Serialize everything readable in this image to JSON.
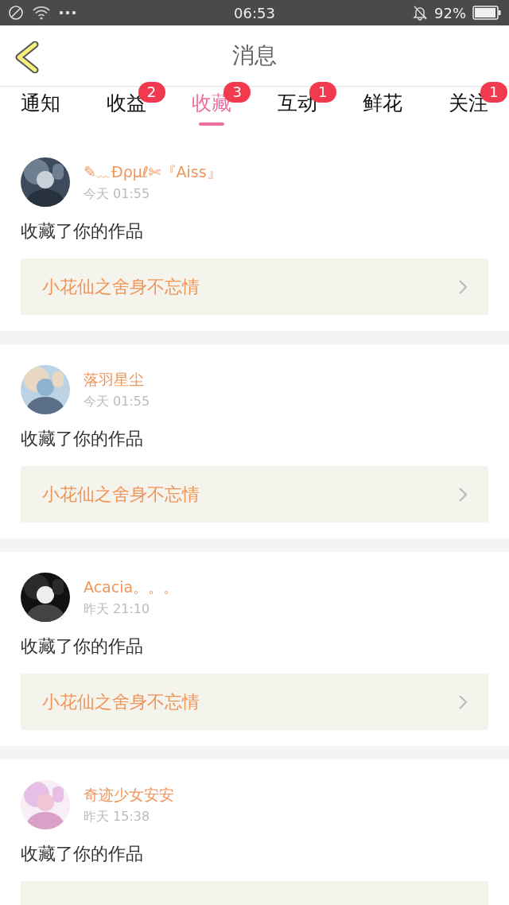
{
  "status_bar": {
    "time": "06:53",
    "battery": "92%"
  },
  "header": {
    "title": "消息"
  },
  "tabs": [
    {
      "label": "通知",
      "selected": false
    },
    {
      "label": "收益",
      "selected": false,
      "badge": "2"
    },
    {
      "label": "收藏",
      "selected": true,
      "badge": "3"
    },
    {
      "label": "互动",
      "selected": false,
      "badge": "1"
    },
    {
      "label": "鲜花",
      "selected": false
    },
    {
      "label": "关注",
      "selected": false,
      "badge": "1"
    }
  ],
  "messages": [
    {
      "user": "✎﹏Ðρμℓ✄『Aiss』",
      "time": "今天 01:55",
      "action": "收藏了你的作品",
      "work_title": "小花仙之舍身不忘情"
    },
    {
      "user": "落羽星尘",
      "time": "今天 01:55",
      "action": "收藏了你的作品",
      "work_title": "小花仙之舍身不忘情"
    },
    {
      "user": "Acacia。。。",
      "time": "昨天 21:10",
      "action": "收藏了你的作品",
      "work_title": "小花仙之舍身不忘情"
    },
    {
      "user": "奇迹少女安安",
      "time": "昨天 15:38",
      "action": "收藏了你的作品"
    }
  ]
}
